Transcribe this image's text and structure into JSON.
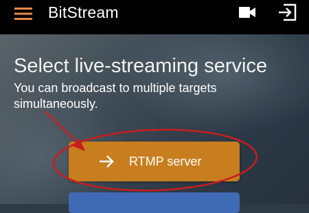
{
  "app": {
    "title": "BitStream"
  },
  "icons": {
    "menu": "hamburger-menu-icon",
    "camera": "video-camera-icon",
    "exit": "exit-icon",
    "arrow": "arrow-right-icon"
  },
  "main": {
    "heading": "Select live-streaming service",
    "subtitle": "You can broadcast to multiple targets simultaneously.",
    "rtmp_button": {
      "label": "RTMP server"
    }
  },
  "colors": {
    "accent": "#e8894a",
    "rtmp_button": "#c87e1e",
    "second_button": "#3f6bb5",
    "annotation": "#c81e1e"
  }
}
